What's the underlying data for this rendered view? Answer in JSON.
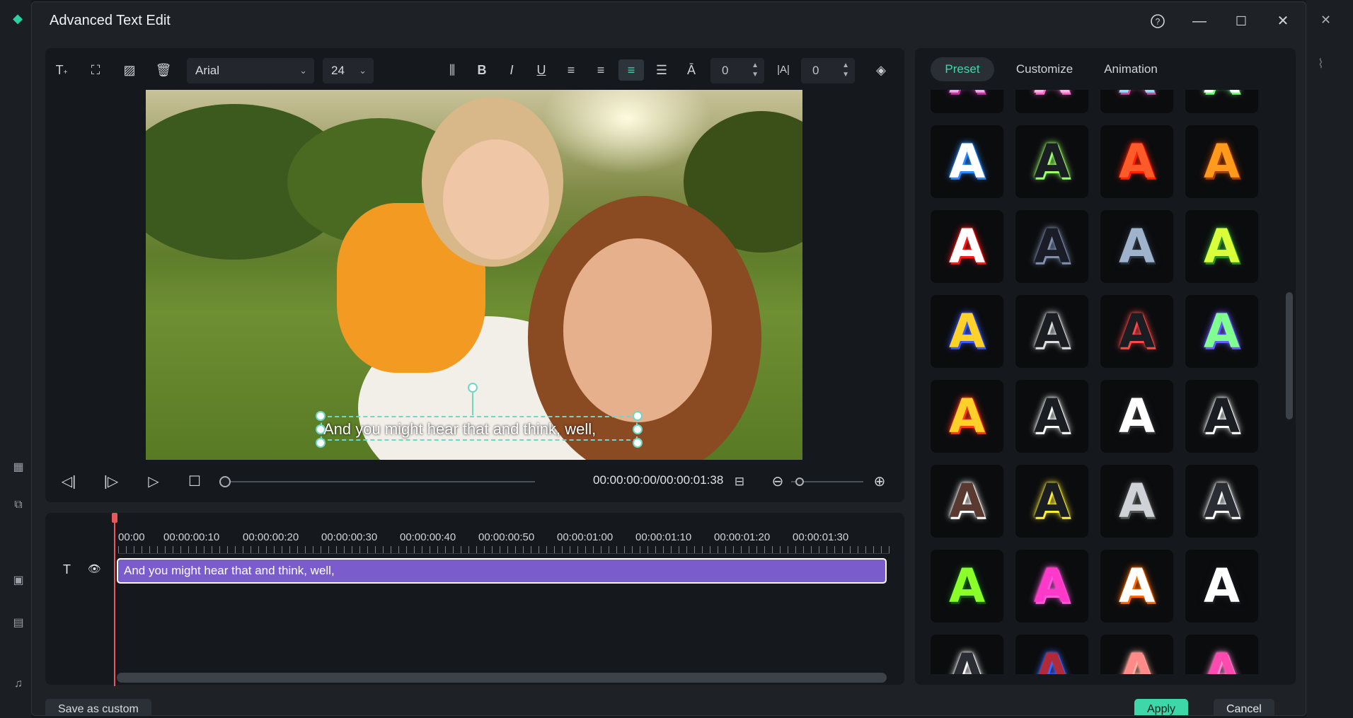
{
  "dialog": {
    "title": "Advanced Text Edit",
    "help_icon": "help-icon",
    "minimize_icon": "minimize-icon",
    "maximize_icon": "maximize-icon",
    "close_icon": "close-icon"
  },
  "toolbar": {
    "font": "Arial",
    "size": "24",
    "char_spacing": "0",
    "line_spacing": "0",
    "icons": [
      "add-text-icon",
      "text-box-icon",
      "image-icon",
      "delete-icon",
      "vertical-text-icon",
      "bold-icon",
      "italic-icon",
      "underline-icon",
      "align-left-icon",
      "align-right-icon",
      "align-center-icon",
      "justify-icon",
      "baseline-icon",
      "spacing-icon",
      "layers-icon"
    ]
  },
  "preview": {
    "caption": "And you might hear that and think, well,"
  },
  "controls": {
    "timecode": "00:00:00:00/00:00:01:38"
  },
  "timeline": {
    "labels": [
      "00:00",
      "00:00:00:10",
      "00:00:00:20",
      "00:00:00:30",
      "00:00:00:40",
      "00:00:00:50",
      "00:00:01:00",
      "00:00:01:10",
      "00:00:01:20",
      "00:00:01:30"
    ],
    "clip_text": "And you might hear that and think, well,"
  },
  "panel": {
    "tabs": [
      "Preset",
      "Customize",
      "Animation"
    ],
    "active_tab": "Preset"
  },
  "presets": [
    {
      "letter": "A",
      "color": "#f2a9e6",
      "glow": "#c03aa0"
    },
    {
      "letter": "A",
      "color": "#ffb4e6",
      "glow": "#ff6cc8"
    },
    {
      "letter": "A",
      "color": "#8fe2ff",
      "glow": "#d04fa0"
    },
    {
      "letter": "A",
      "color": "#ffffff",
      "glow": "#6fff7a"
    },
    {
      "letter": "A",
      "color": "#ffffff",
      "glow": "#2a8cff"
    },
    {
      "letter": "A",
      "color": "#1a1d22",
      "glow": "#9dff6a"
    },
    {
      "letter": "A",
      "color": "#ff5a2a",
      "glow": "#ff2200"
    },
    {
      "letter": "A",
      "color": "#ff9a1a",
      "glow": "#a04000"
    },
    {
      "letter": "A",
      "color": "#ffffff",
      "glow": "#ff1a1a"
    },
    {
      "letter": "A",
      "color": "#1a1d28",
      "glow": "#8090b0"
    },
    {
      "letter": "A",
      "color": "#9fb4cc",
      "glow": "#2a3440"
    },
    {
      "letter": "A",
      "color": "#d8ff3a",
      "glow": "#2f8f2a"
    },
    {
      "letter": "A",
      "color": "#ffd22a",
      "glow": "#3a5cff"
    },
    {
      "letter": "A",
      "color": "#1a1d22",
      "glow": "#e0e0e0"
    },
    {
      "letter": "A",
      "color": "#1a1d22",
      "glow": "#ff4a4a"
    },
    {
      "letter": "A",
      "color": "#80ff90",
      "glow": "#6a5cff"
    },
    {
      "letter": "A",
      "color": "#ffd02a",
      "glow": "#ff3a1a"
    },
    {
      "letter": "A",
      "color": "#1a1d22",
      "glow": "#ffffff"
    },
    {
      "letter": "A",
      "color": "#ffffff",
      "glow": "#333333"
    },
    {
      "letter": "A",
      "color": "#1a1d22",
      "glow": "#ffffff"
    },
    {
      "letter": "A",
      "color": "#5a3a30",
      "glow": "#ffffff"
    },
    {
      "letter": "A",
      "color": "#1a1d22",
      "glow": "#ffee3a"
    },
    {
      "letter": "A",
      "color": "#cfd2d6",
      "glow": "#555555"
    },
    {
      "letter": "A",
      "color": "#2a2d33",
      "glow": "#ffffff"
    },
    {
      "letter": "A",
      "color": "#8aff2a",
      "glow": "#1a5a1a"
    },
    {
      "letter": "A",
      "color": "#ff3ac8",
      "glow": "#ff5ae0"
    },
    {
      "letter": "A",
      "color": "#ffffff",
      "glow": "#ff6a00"
    },
    {
      "letter": "A",
      "color": "#ffffff",
      "glow": "#1a1d22"
    },
    {
      "letter": "A",
      "color": "#2a2d33",
      "glow": "#ffffff"
    },
    {
      "letter": "A",
      "color": "#b02a3a",
      "glow": "#3a6aff"
    },
    {
      "letter": "A",
      "color": "#ff8a8a",
      "glow": "#ffb0a0"
    },
    {
      "letter": "A",
      "color": "#ff4ab0",
      "glow": "#ff8ad0"
    }
  ],
  "footer": {
    "save_custom": "Save as custom",
    "apply": "Apply",
    "cancel": "Cancel"
  }
}
